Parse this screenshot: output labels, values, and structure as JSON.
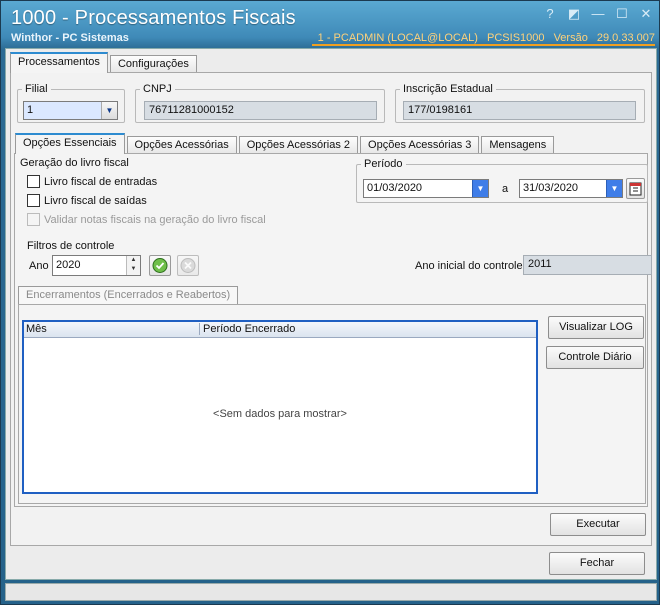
{
  "window": {
    "title": "1000 - Processamentos Fiscais",
    "company": "Winthor - PC Sistemas",
    "info": [
      "1 - PCADMIN (LOCAL@LOCAL)",
      "PCSIS1000",
      "Versão",
      "29.0.33.007"
    ]
  },
  "main_tabs": [
    "Processamentos",
    "Configurações"
  ],
  "filial": {
    "legend": "Filial",
    "value": "1"
  },
  "cnpj": {
    "legend": "CNPJ",
    "value": "76711281000152"
  },
  "ie": {
    "legend": "Inscrição Estadual",
    "value": "177/0198161"
  },
  "sub_tabs": [
    "Opções Essenciais",
    "Opções Acessórias",
    "Opções Acessórias 2",
    "Opções Acessórias 3",
    "Mensagens"
  ],
  "geracao": {
    "legend": "Geração do livro fiscal",
    "entradas": "Livro fiscal de entradas",
    "saidas": "Livro fiscal de saídas",
    "validar": "Validar notas fiscais na geração do livro fiscal"
  },
  "periodo": {
    "legend": "Período",
    "inicio": "01/03/2020",
    "sep": "a",
    "fim": "31/03/2020"
  },
  "filtros": {
    "legend": "Filtros de controle",
    "ano_label": "Ano",
    "ano_value": "2020",
    "ano_inicial_label": "Ano inicial do controle",
    "ano_inicial_value": "2011"
  },
  "encerramentos": {
    "tab": "Encerramentos (Encerrados e Reabertos)",
    "columns": [
      "Mês",
      "Período Encerrado"
    ],
    "empty": "<Sem dados para mostrar>"
  },
  "buttons": {
    "log": "Visualizar LOG",
    "controle": "Controle Diário",
    "executar": "Executar",
    "fechar": "Fechar"
  },
  "colors": {
    "accent": "#1f5fc2",
    "title_bg": "#2c6b94",
    "info_text": "#ffd27a"
  }
}
